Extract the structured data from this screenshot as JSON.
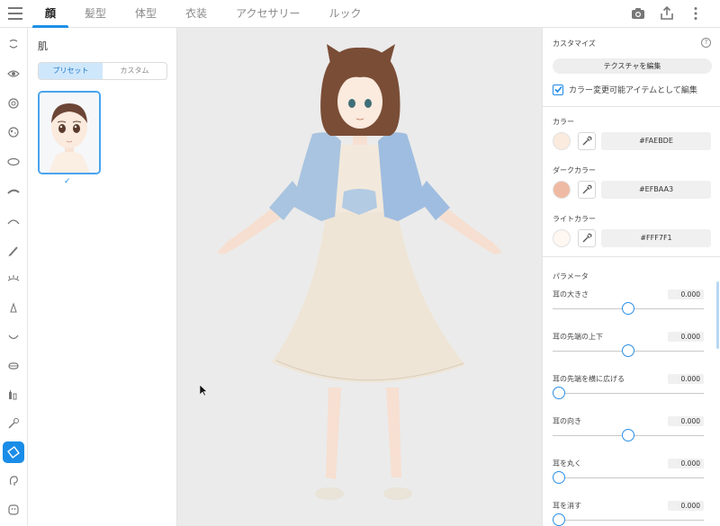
{
  "tabs": [
    "顔",
    "髪型",
    "体型",
    "衣装",
    "アクセサリー",
    "ルック"
  ],
  "active_tab": 0,
  "top_icons": [
    "camera-icon",
    "share-icon",
    "more-vertical-icon"
  ],
  "rail_icons": [
    "face-outline-icon",
    "eye-icon",
    "iris-icon",
    "eye-highlight-icon",
    "eye-white-icon",
    "eyebrow-icon",
    "eyelid-icon",
    "eyeliner-icon",
    "eyelash-icon",
    "nose-icon",
    "mouth-icon",
    "teeth-icon",
    "face-shape-icon",
    "makeup-brush-icon",
    "skin-icon",
    "ear-icon",
    "face-paint-icon"
  ],
  "rail_active": 14,
  "skin_panel": {
    "title": "肌",
    "preset_label": "プリセット",
    "custom_label": "カスタム",
    "check": "✓"
  },
  "customize": {
    "title": "カスタマイズ",
    "help": "?",
    "texture_button": "テクスチャを編集",
    "checkbox_label": "カラー変更可能アイテムとして編集",
    "checkbox_checked": true
  },
  "colors": [
    {
      "label": "カラー",
      "hex": "#FAEBDE",
      "swatch": "#FAEBDE"
    },
    {
      "label": "ダークカラー",
      "hex": "#EFBAA3",
      "swatch": "#EFBAA3"
    },
    {
      "label": "ライトカラー",
      "hex": "#FFF7F1",
      "swatch": "#FFF7F1"
    }
  ],
  "parameters": {
    "title": "パラメータ",
    "items": [
      {
        "label": "耳の大きさ",
        "value": "0.000",
        "level": 0.5
      },
      {
        "label": "耳の先端の上下",
        "value": "0.000",
        "level": 0.5
      },
      {
        "label": "耳の先端を横に広げる",
        "value": "0.000",
        "level": 0.0
      },
      {
        "label": "耳の向き",
        "value": "0.000",
        "level": 0.5
      },
      {
        "label": "耳を丸く",
        "value": "0.000",
        "level": 0.0
      },
      {
        "label": "耳を消す",
        "value": "0.000",
        "level": 0.0
      }
    ]
  },
  "accent": "#1E8AE6"
}
